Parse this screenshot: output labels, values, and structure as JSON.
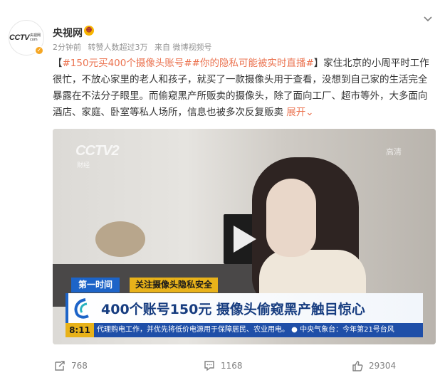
{
  "author": {
    "name": "央视网",
    "avatar_logo": "CCTV",
    "avatar_sub": "央视网com",
    "verified_icon": "verified-badge-icon",
    "vip_icon": "vip-emoji-icon"
  },
  "meta": {
    "time": "2分钟前",
    "reposts_summary": "转赞人数超过3万",
    "source": "来自 微博视频号"
  },
  "post": {
    "bracket_open": "【",
    "hashtag_1": "#150元买400个摄像头账号#",
    "hashtag_2": "#你的隐私可能被实时直播#",
    "bracket_close": "】",
    "body": "家住北京的小周平时工作很忙，不放心家里的老人和孩子，就买了一款摄像头用于查看，没想到自己家的生活完全暴露在不法分子眼里。而偷窥黑产所贩卖的摄像头，除了面向工厂、超市等外，大多面向酒店、家庭、卧室等私人场所，信息也被多次反复贩卖",
    "expand_label": "展开"
  },
  "video": {
    "watermark": "CCTV2",
    "watermark_sub": "财经",
    "corner_mark": "高清",
    "tag_program": "第一时间",
    "tag_topic": "关注摄像头隐私安全",
    "headline": "400个账号150元 摄像头偷窥黑产触目惊心",
    "ticker_time": "8:11",
    "ticker_text": "代理购电工作，并优先将低价电源用于保障居民、农业用电。     ● 中央气象台：今年第21号台风"
  },
  "actions": {
    "repost_count": "768",
    "comment_count": "1168",
    "like_count": "29304"
  },
  "colors": {
    "accent": "#eb7350",
    "meta": "#939393",
    "cctv_blue": "#1d64c8",
    "cctv_yellow": "#e8b21a"
  }
}
